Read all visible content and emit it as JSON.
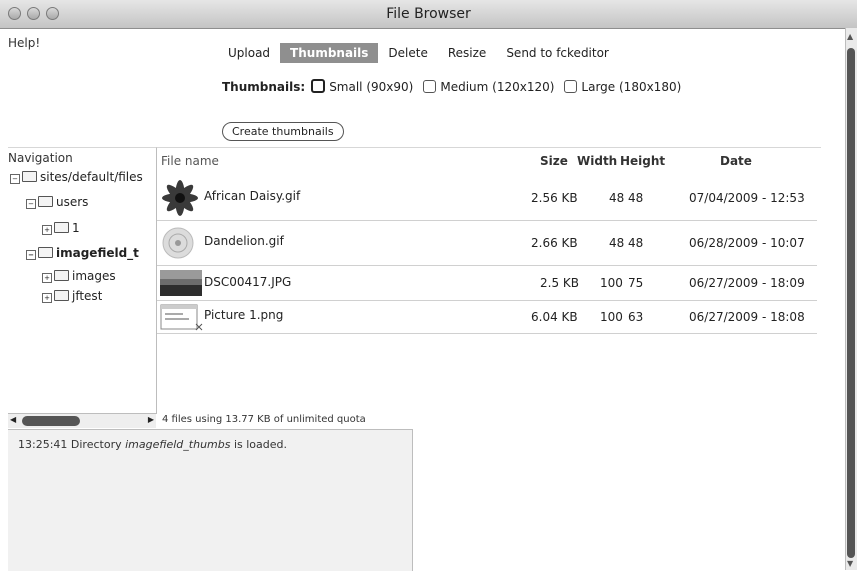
{
  "window": {
    "title": "File Browser"
  },
  "help_label": "Help!",
  "tabs": [
    {
      "label": "Upload",
      "active": false
    },
    {
      "label": "Thumbnails",
      "active": true
    },
    {
      "label": "Delete",
      "active": false
    },
    {
      "label": "Resize",
      "active": false
    },
    {
      "label": "Send to fckeditor",
      "active": false
    }
  ],
  "thumbnails": {
    "label": "Thumbnails:",
    "options": [
      "Small (90x90)",
      "Medium (120x120)",
      "Large (180x180)"
    ],
    "button": "Create thumbnails"
  },
  "navigation": {
    "title": "Navigation",
    "tree": [
      {
        "label": "sites/default/files",
        "toggle": "−"
      },
      {
        "label": "users",
        "toggle": "−"
      },
      {
        "label": "1",
        "toggle": "+"
      },
      {
        "label": "imagefield_t",
        "toggle": "−"
      },
      {
        "label": "images",
        "toggle": "+"
      },
      {
        "label": "jftest",
        "toggle": "+"
      }
    ]
  },
  "files": {
    "headers": {
      "name": "File name",
      "size": "Size",
      "width": "Width",
      "height": "Height",
      "date": "Date"
    },
    "rows": [
      {
        "name": "African Daisy.gif",
        "size": "2.56 KB",
        "width": "48",
        "height": "48",
        "date": "07/04/2009 - 12:53"
      },
      {
        "name": "Dandelion.gif",
        "size": "2.66 KB",
        "width": "48",
        "height": "48",
        "date": "06/28/2009 - 10:07"
      },
      {
        "name": "DSC00417.JPG",
        "size": "2.5 KB",
        "width": "100",
        "height": "75",
        "date": "06/27/2009 - 18:09"
      },
      {
        "name": "Picture 1.png",
        "size": "6.04 KB",
        "width": "100",
        "height": "63",
        "date": "06/27/2009 - 18:08"
      }
    ]
  },
  "status": {
    "quota": "4 files using 13.77 KB of unlimited quota"
  },
  "log": {
    "time": "13:25:41",
    "prefix": "Directory",
    "dir": "imagefield_thumbs",
    "suffix": "is loaded."
  }
}
